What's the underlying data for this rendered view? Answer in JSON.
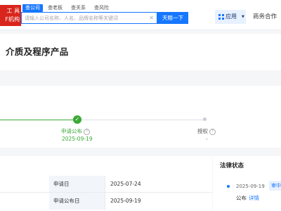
{
  "brand": {
    "line1": "工 具",
    "line2": "F机构"
  },
  "search": {
    "tabs": [
      "查公司",
      "查老板",
      "查关系",
      "查风险"
    ],
    "placeholder": "请输入公司名称、人名、品牌名称等关键词",
    "button": "天眼一下"
  },
  "nav": {
    "apps": "应用",
    "business": "商务合作"
  },
  "page_title": "介质及程序产品",
  "progress": {
    "steps": [
      {
        "label": "申请公布",
        "date": "2025-09-19",
        "status": "done"
      },
      {
        "label": "授权",
        "date": "-",
        "status": "pending"
      }
    ]
  },
  "info_table": {
    "rows": [
      {
        "key": "申请日",
        "value": "2025-07-24"
      },
      {
        "key": "申请公布日",
        "value": "2025-09-19"
      }
    ]
  },
  "legal": {
    "title": "法律状态",
    "items": [
      {
        "date": "2025-09-19",
        "badge": "审中",
        "type": "公布",
        "link": "详情"
      }
    ]
  },
  "colors": {
    "primary": "#1677ff",
    "success": "#3aaa35",
    "brand_red": "#d9261c"
  }
}
